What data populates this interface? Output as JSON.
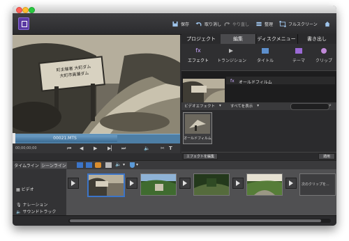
{
  "toolbar": {
    "save": "保存",
    "undo": "取り消し",
    "redo": "やり直し",
    "organize": "整理",
    "fullscreen": "フルスクリーン"
  },
  "preview": {
    "sign_line1": "町主催者 大町ダム",
    "sign_line2": "大町市高瀬ダム",
    "timecode": "00021.MTS",
    "time": "00;00;00;00"
  },
  "tabs": [
    "プロジェクト",
    "編集",
    "ディスクメニュー",
    "書き出し"
  ],
  "subtabs": [
    "エフェクト",
    "トランジション",
    "タイトル",
    "テーマ",
    "クリップ"
  ],
  "effects": {
    "item_label": "オールドフィルム",
    "filter_dropdown": "ビデオエフェクト",
    "show_dropdown": "すべてを表示",
    "gallery_item_label": "オールドフィルム",
    "edit_button": "エフェクトを編集",
    "apply_button": "適用"
  },
  "timeline": {
    "tab_timeline": "タイムライン",
    "tab_sceneline": "シーンライン",
    "track_video": "ビデオ",
    "track_narration": "ナレーション",
    "track_soundtrack": "サウンドトラック",
    "next_clip": "次のクリップを..."
  },
  "colors": {
    "accent_blue": "#4d7ea5",
    "selected_blue": "#3c75c8",
    "toolbar_bg": "#2b2b2d"
  }
}
